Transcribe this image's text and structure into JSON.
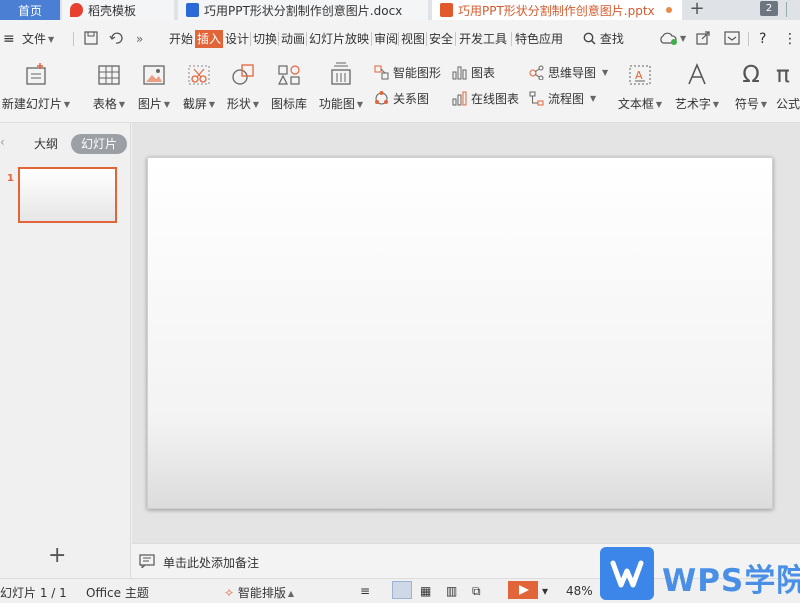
{
  "tabs": {
    "home": "首页",
    "docer": "稻壳模板",
    "doc": "巧用PPT形状分割制作创意图片.docx",
    "ppt": "巧用PPT形状分割制作创意图片.pptx",
    "add": "+",
    "window_count": "2"
  },
  "menu": {
    "hamburger": "≡",
    "file": "文件",
    "items": [
      "开始",
      "插入",
      "设计",
      "切换",
      "动画",
      "幻灯片放映",
      "审阅",
      "视图",
      "安全",
      "开发工具",
      "特色应用"
    ],
    "active_index": 1,
    "search": "查找"
  },
  "ribbon": {
    "new_slide": "新建幻灯片",
    "table": "表格",
    "picture": "图片",
    "screenshot": "截屏",
    "shape": "形状",
    "icon_lib": "图标库",
    "function_chart": "功能图",
    "smart_shape": "智能图形",
    "chart": "图表",
    "mind_map": "思维导图",
    "relation": "关系图",
    "online_chart": "在线图表",
    "flowchart": "流程图",
    "textbox": "文本框",
    "wordart": "艺术字",
    "symbol": "符号",
    "formula": "公式"
  },
  "left_panel": {
    "outline": "大纲",
    "slides": "幻灯片",
    "slide_number": "1",
    "add": "+"
  },
  "notes": {
    "placeholder": "单击此处添加备注"
  },
  "status": {
    "slide_counter": "幻灯片 1 / 1",
    "theme": "Office 主题",
    "smart_layout": "智能排版",
    "zoom": "48%"
  },
  "watermark": {
    "text": "WPS学院"
  },
  "colors": {
    "accent": "#e2653a",
    "home_tab": "#4a7fd4",
    "watermark": "#3b86e8"
  }
}
